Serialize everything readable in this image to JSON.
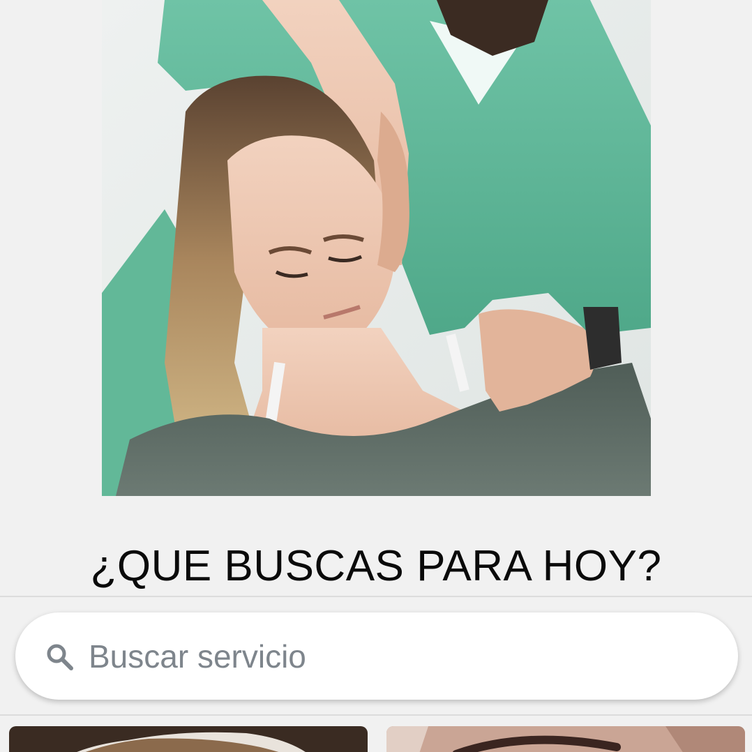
{
  "hero": {
    "image_name": "physiotherapy-neck-stretch-photo"
  },
  "heading": {
    "title": "¿QUE BUSCAS PARA HOY?"
  },
  "search": {
    "placeholder": "Buscar servicio",
    "value": "",
    "icon": "search-icon"
  },
  "services": {
    "cards": [
      {
        "image_name": "service-card-hair-photo"
      },
      {
        "image_name": "service-card-eyebrows-photo"
      }
    ]
  },
  "colors": {
    "background": "#f1f1f1",
    "scrubs": "#5fb89a",
    "placeholder": "#7e858c",
    "heading": "#0a0a0a"
  }
}
